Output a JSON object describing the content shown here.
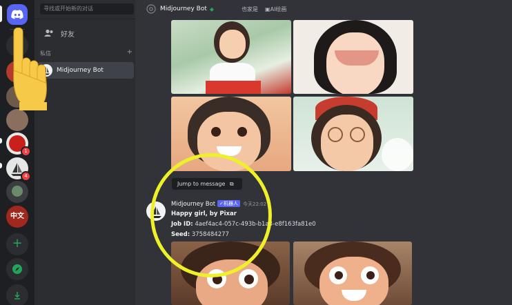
{
  "channels": {
    "search_placeholder": "寻找或开始新的对话",
    "friends_label": "好友",
    "dm_section_label": "私信",
    "dm_add": "+",
    "dm_active_name": "Midjourney Bot"
  },
  "header": {
    "channel_name": "Midjourney Bot",
    "favorites": "也家是",
    "ai_drawing": "AI绘画"
  },
  "rail": {
    "badges": [
      "1",
      "4"
    ],
    "mini_labels": [
      "中文"
    ]
  },
  "message": {
    "jump_label": "Jump to message",
    "author": "Midjourney Bot",
    "bot_tag": "✓机器人",
    "time": "今天22:02",
    "prompt": "Happy girl, by Pixar",
    "job_label": "Job ID:",
    "job_id": "4aef4ac4-057c-493b-b1a3-e8f163fa81e0",
    "seed_label": "Seed:",
    "seed": "3758484277"
  },
  "colors": {
    "rail_bg": "#1e1f22",
    "sidebar_bg": "#2b2d31",
    "main_bg": "#313338",
    "accent": "#5865f2",
    "highlight_circle": "#eef02a"
  }
}
